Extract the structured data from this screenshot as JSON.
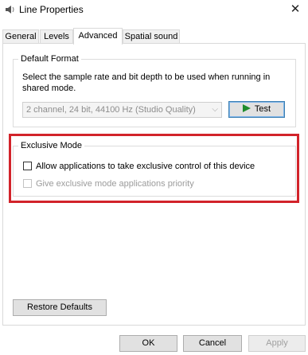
{
  "window": {
    "title": "Line Properties",
    "close_glyph": "✕",
    "icon": "speaker-icon"
  },
  "tabs": [
    {
      "label": "General",
      "active": false
    },
    {
      "label": "Levels",
      "active": false
    },
    {
      "label": "Advanced",
      "active": true
    },
    {
      "label": "Spatial sound",
      "active": false
    }
  ],
  "default_format": {
    "legend": "Default Format",
    "description": "Select the sample rate and bit depth to be used when running in shared mode.",
    "selected_format": "2 channel, 24 bit, 44100 Hz (Studio Quality)",
    "test_label": "Test"
  },
  "exclusive_mode": {
    "legend": "Exclusive Mode",
    "allow_label": "Allow applications to take exclusive control of this device",
    "allow_checked": false,
    "priority_label": "Give exclusive mode applications priority",
    "priority_checked": false,
    "priority_enabled": false
  },
  "buttons": {
    "restore_defaults": "Restore Defaults",
    "ok": "OK",
    "cancel": "Cancel",
    "apply": "Apply"
  },
  "colors": {
    "highlight": "#d2232a",
    "test_accent": "#3c7fb1",
    "play_icon": "#1f8c2c"
  }
}
